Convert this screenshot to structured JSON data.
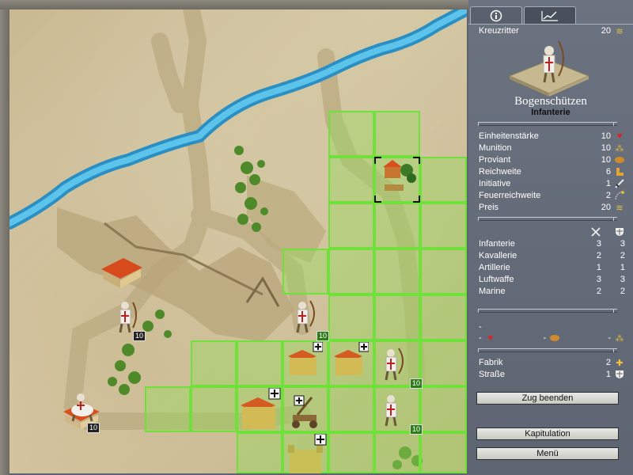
{
  "panel": {
    "tabs": [
      {
        "icon": "info-icon",
        "glyph": "ⓘ"
      },
      {
        "icon": "chart-icon",
        "glyph": "📈"
      }
    ],
    "faction": "Kreuzritter",
    "faction_value": "20",
    "unit_name": "Bogenschützen",
    "unit_type": "Infanterie",
    "stats": [
      {
        "label": "Einheitenstärke",
        "value": "10",
        "icon": "heart-icon"
      },
      {
        "label": "Munition",
        "value": "10",
        "icon": "ammo-icon"
      },
      {
        "label": "Proviant",
        "value": "10",
        "icon": "bread-icon"
      },
      {
        "label": "Reichweite",
        "value": "6",
        "icon": "boot-icon"
      },
      {
        "label": "Initiative",
        "value": "1",
        "icon": "sword-icon"
      },
      {
        "label": "Feuerreichweite",
        "value": "2",
        "icon": "range-icon"
      },
      {
        "label": "Preis",
        "value": "20",
        "icon": "gold-icon"
      }
    ],
    "combat_headers": {
      "attack_icon": "crossed-swords-icon",
      "defense_icon": "shield-icon"
    },
    "combat": [
      {
        "label": "Infanterie",
        "attack": "3",
        "defense": "3"
      },
      {
        "label": "Kavallerie",
        "attack": "2",
        "defense": "2"
      },
      {
        "label": "Artillerie",
        "attack": "1",
        "defense": "1"
      },
      {
        "label": "Luftwaffe",
        "attack": "3",
        "defense": "3"
      },
      {
        "label": "Marine",
        "attack": "2",
        "defense": "2"
      }
    ],
    "cost_dash": "-",
    "costs": [
      {
        "value": "-",
        "icon": "heart-icon"
      },
      {
        "value": "-",
        "icon": "bread-icon"
      },
      {
        "value": "-",
        "icon": "ammo-icon"
      }
    ],
    "bonuses": [
      {
        "label": "Fabrik",
        "value": "2",
        "icon": "plus-icon"
      },
      {
        "label": "Straße",
        "value": "1",
        "icon": "shield-icon"
      }
    ],
    "buttons": {
      "end_turn": "Zug beenden",
      "capitulation": "Kapitulation",
      "menu": "Menü"
    }
  },
  "map": {
    "unit_badges": [
      "10",
      "10",
      "10",
      "10",
      "10",
      "10"
    ],
    "colors": {
      "highlight": "#6fe13a",
      "water": "#3aa7d6",
      "sand": "#d1c39d"
    }
  }
}
